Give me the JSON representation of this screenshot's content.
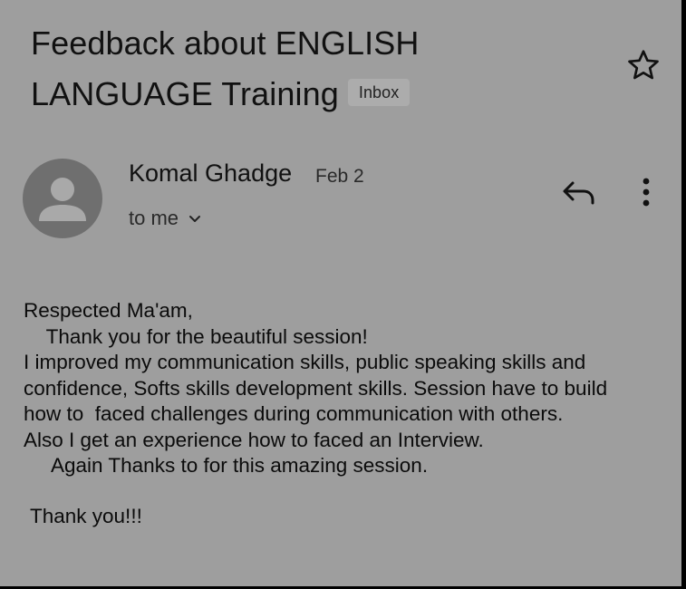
{
  "email": {
    "subject_line1": "Feedback about ENGLISH",
    "subject_line2": "LANGUAGE Training",
    "label": "Inbox",
    "sender_name": "Komal Ghadge",
    "date": "Feb 2",
    "recipient": "to me",
    "body_lines": [
      "Respected Ma'am,",
      "    Thank you for the beautiful session!",
      "I improved my communication skills, public speaking skills and",
      "confidence, Softs skills development skills. Session have to build",
      "how to  faced challenges during communication with others.",
      "Also I get an experience how to faced an Interview.",
      "     Again Thanks to for this amazing session."
    ],
    "closing": "Thank you!!!"
  },
  "icons": {
    "star": "star-outline-icon",
    "avatar": "person-icon",
    "reply": "reply-icon",
    "more": "more-vertical-icon",
    "chevron": "chevron-down-icon"
  },
  "colors": {
    "background": "#9e9e9e",
    "avatar_bg": "#6f6f6f",
    "badge_bg": "#acacac",
    "text": "#0b0b0b"
  }
}
